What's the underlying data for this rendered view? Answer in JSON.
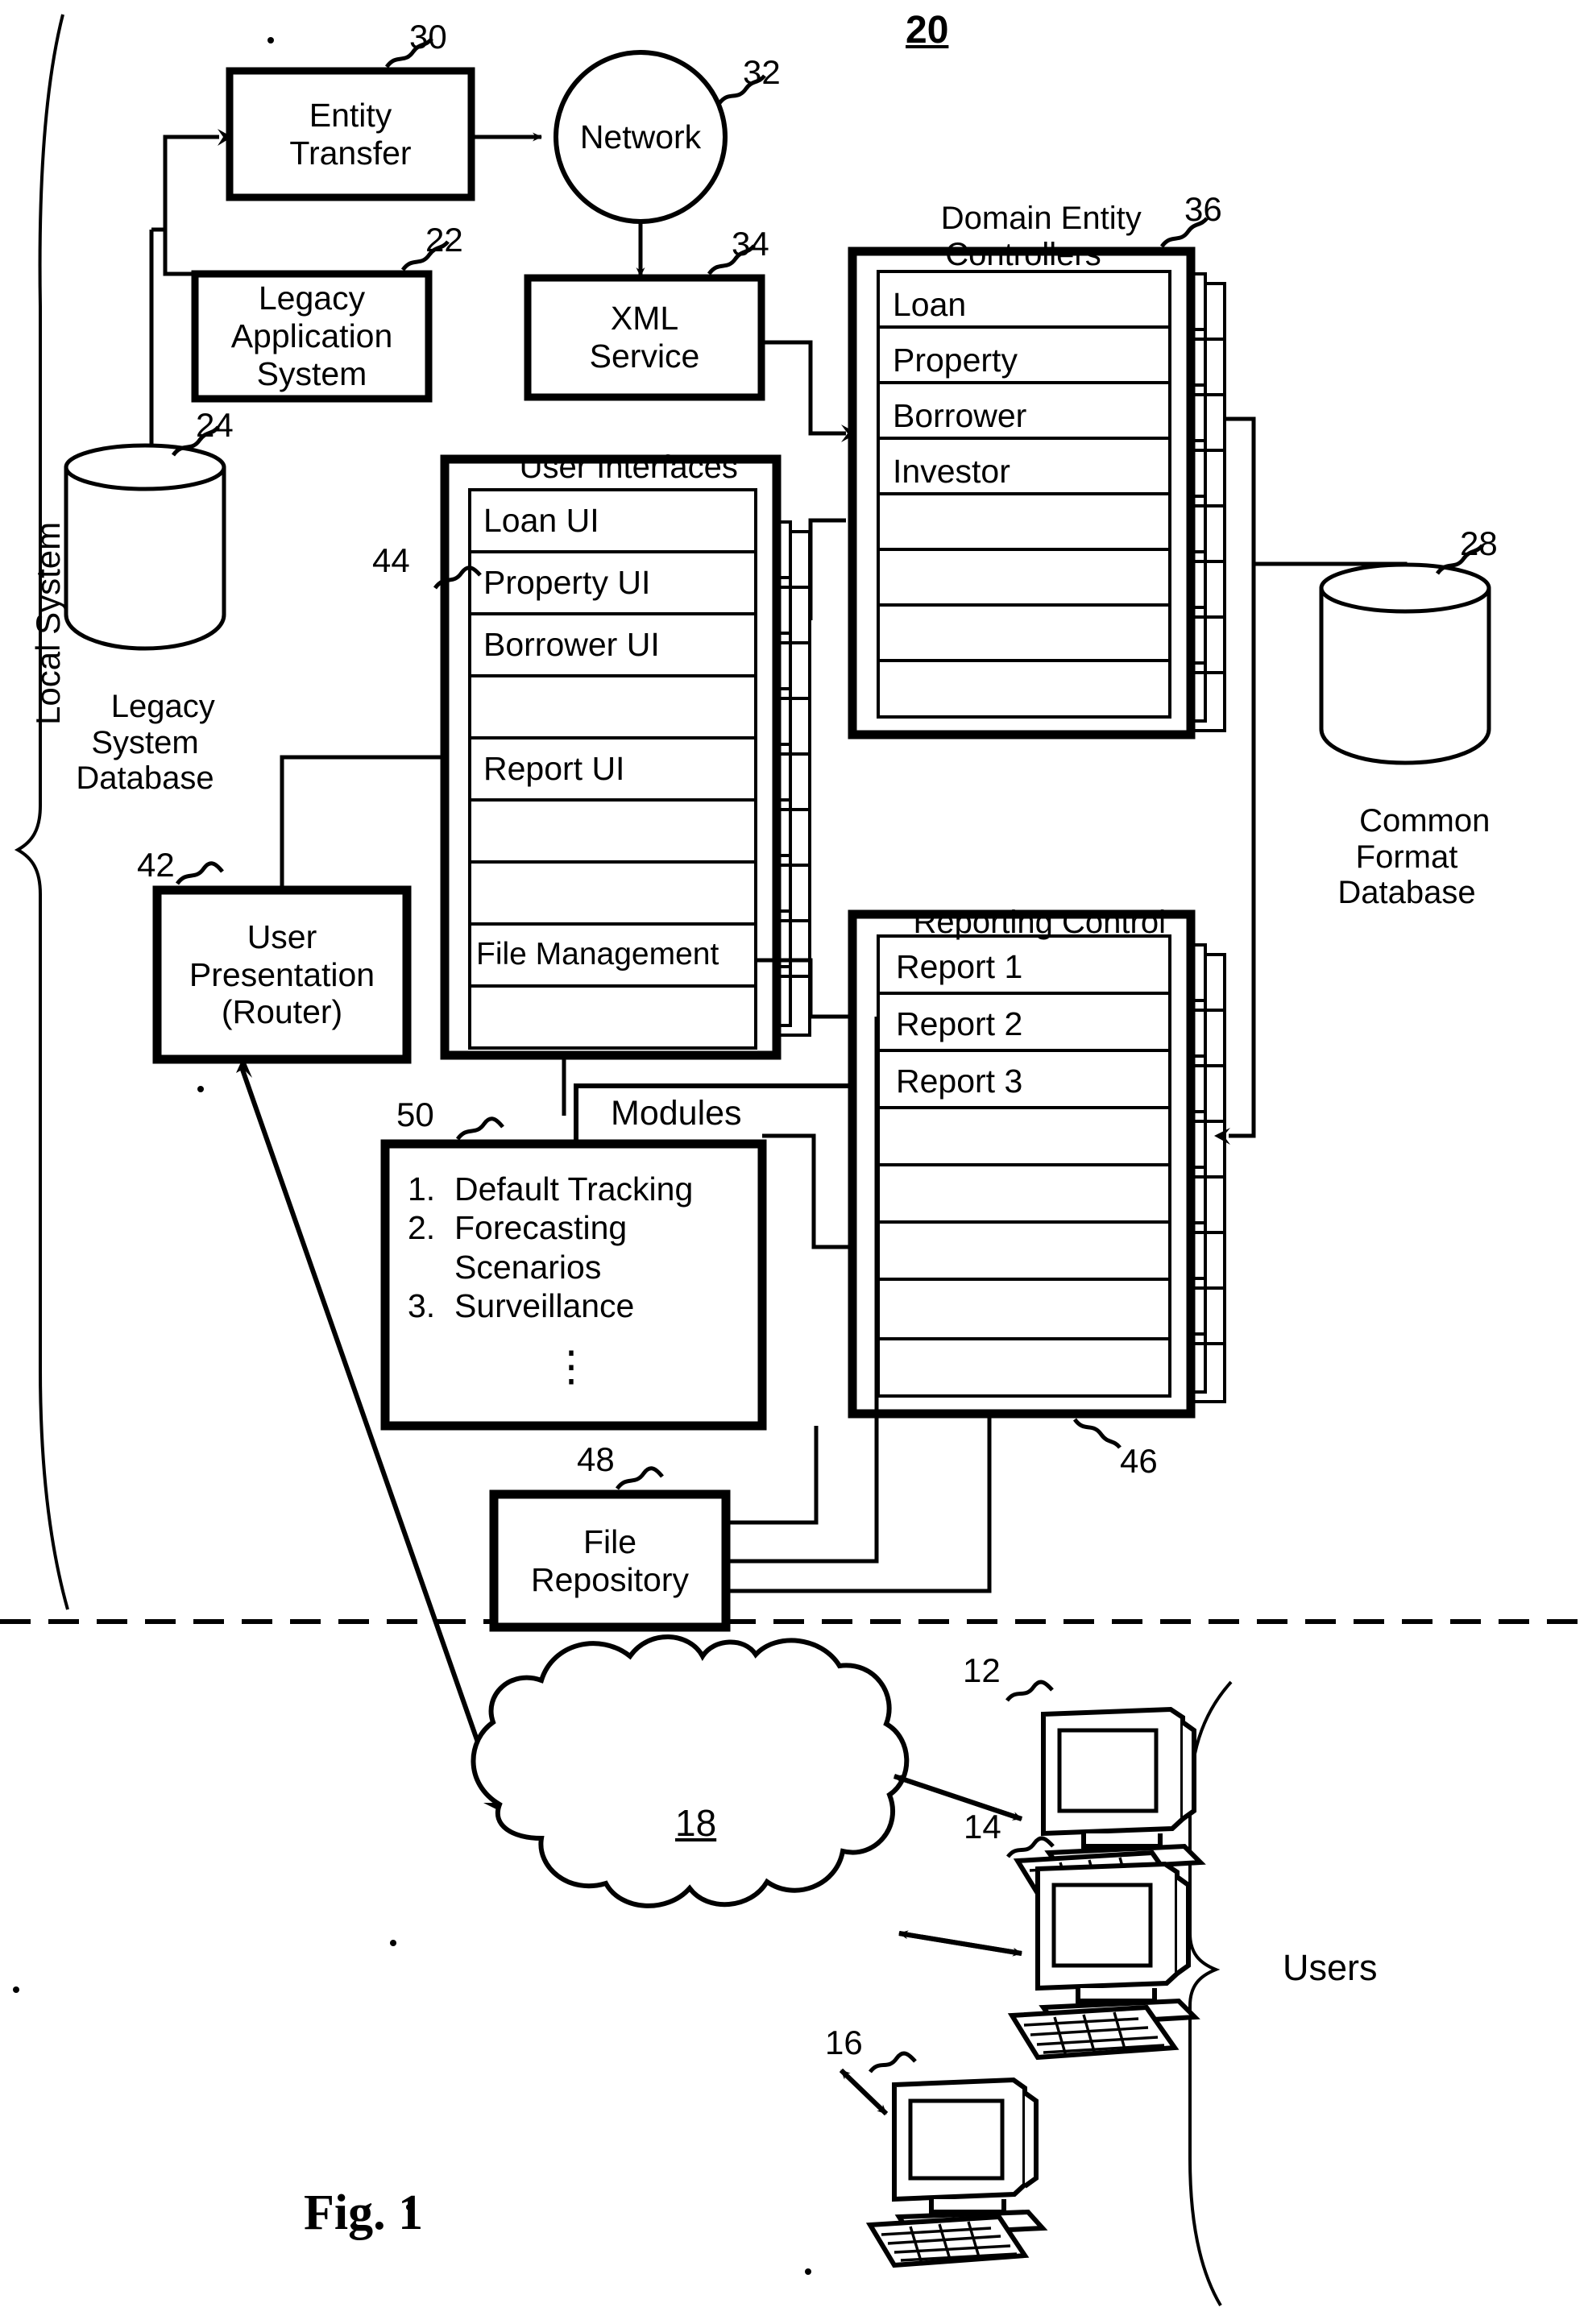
{
  "figure": {
    "number_label": "20",
    "caption": "Fig. 1"
  },
  "regions": {
    "local_system_label": "Local System",
    "users_label": "Users"
  },
  "blocks": {
    "entity_transfer": {
      "label": "Entity\nTransfer",
      "ref": "30"
    },
    "network": {
      "label": "Network",
      "ref": "32"
    },
    "legacy_application_system": {
      "label": "Legacy\nApplication\nSystem",
      "ref": "22"
    },
    "xml_service": {
      "label": "XML\nService",
      "ref": "34"
    },
    "legacy_system_database": {
      "label": "Legacy\nSystem\nDatabase",
      "ref": "24"
    },
    "common_format_database": {
      "label": "Common\nFormat\nDatabase",
      "ref": "28"
    },
    "user_presentation_router": {
      "label": "User\nPresentation\n(Router)",
      "ref": "42"
    },
    "file_repository": {
      "label": "File\nRepository",
      "ref": "48"
    },
    "internet_cloud": {
      "label": "18"
    }
  },
  "stacks": {
    "domain_entity_controllers": {
      "title": "Domain Entity\nControllers",
      "ref": "36",
      "rows": [
        "Loan",
        "Property",
        "Borrower",
        "Investor",
        "",
        "",
        "",
        ""
      ]
    },
    "user_interfaces": {
      "title": "User Interfaces",
      "ref": "44",
      "rows": [
        "Loan UI",
        "Property UI",
        "Borrower UI",
        "",
        "Report UI",
        "",
        "",
        "File Management",
        ""
      ]
    },
    "reporting_control": {
      "title": "Reporting Control",
      "ref": "46",
      "rows": [
        "Report 1",
        "Report 2",
        "Report 3",
        "",
        "",
        "",
        "",
        ""
      ]
    }
  },
  "modules": {
    "title": "Modules",
    "ref": "50",
    "items": [
      {
        "num": "1.",
        "label": "Default Tracking"
      },
      {
        "num": "2.",
        "label": "Forecasting"
      },
      {
        "num": "",
        "label": "Scenarios"
      },
      {
        "num": "3.",
        "label": "Surveillance"
      }
    ],
    "continuation": "⋮"
  },
  "terminals": [
    {
      "ref": "12",
      "name": "workstation-1"
    },
    {
      "ref": "14",
      "name": "workstation-2"
    },
    {
      "ref": "16",
      "name": "workstation-3"
    }
  ],
  "colors": {
    "line": "#000000",
    "background": "#ffffff"
  }
}
